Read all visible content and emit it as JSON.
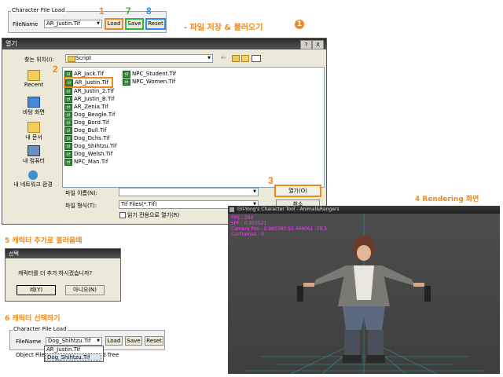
{
  "panel_top": {
    "group_title": "Character File Load",
    "filename_label": "FileName",
    "filename_value": "AR_Justin.Tif",
    "load": "Load",
    "save": "Save",
    "reset": "Reset",
    "step_load": "1",
    "step_save": "7",
    "step_reset": "8"
  },
  "heading_save_load": "- 파일 저장 & 불러오기",
  "heading_save_load_num": "1",
  "open_dialog": {
    "title": "열기",
    "help_btn": "?",
    "close_btn": "X",
    "lookin_label": "찾는 위치(I):",
    "lookin_value": "Script",
    "places": [
      "Recent",
      "바탕 화면",
      "내 문서",
      "내 컴퓨터",
      "내 네트워크 환경"
    ],
    "files_col1": [
      "AR_Jack.Tif",
      "AR_Justin.Tif",
      "AR_Justin_2.Tif",
      "AR_Justin_B.Tif",
      "AR_Zenia.Tif",
      "Dog_Beagle.Tif",
      "Dog_Bord.Tif",
      "Dog_Bull.Tif",
      "Dog_Dchs.Tif",
      "Dog_Shihtzu.Tif",
      "Dog_Welsh.Tif",
      "NPC_Man.Tif"
    ],
    "files_col2": [
      "NPC_Student.Tif",
      "NPC_Women.Tif"
    ],
    "filename_label": "파일 이름(N):",
    "filename_value": "",
    "filetype_label": "파일 형식(T):",
    "filetype_value": "Tif Files(*.Tif)",
    "readonly_label": "읽기 전용으로 열기(R)",
    "open_btn": "열기(O)",
    "cancel_btn": "취소",
    "step_file": "2",
    "step_open": "3"
  },
  "render": {
    "heading": "4  Rendering 화면",
    "title": "Gil-Yong's Character Tool - Animal&Rangers",
    "fps": "FPS : 284",
    "spf": "SPF : 0.003521",
    "camera": "Camera Pos : 0.980363 50.446061 -79.3",
    "frames": "CurFrames : 0"
  },
  "add_section": {
    "heading": "5 캐릭터 추가로 불러올때",
    "dialog_title": "선택",
    "message": "캐릭터를 더 추가 하시겠습니까?",
    "yes": "예(Y)",
    "no": "아니오(N)"
  },
  "select_section": {
    "heading": "6 캐릭터 선택하기",
    "group_title": "Character File Load",
    "filename_label": "FileName",
    "filename_value": "Dog_Shihtzu.Tif",
    "load": "Load",
    "save": "Save",
    "reset": "Reset",
    "object_label": "Object File",
    "tree_label": "d Tree",
    "options": [
      "AR_Justin.Tif",
      "Dog_Shihtzu.Tif"
    ]
  },
  "colors": {
    "orange": "#f08a1e",
    "green": "#2db84b",
    "blue": "#2b8ee8",
    "heading": "#f08a1e",
    "stat": "#ff3aff"
  }
}
